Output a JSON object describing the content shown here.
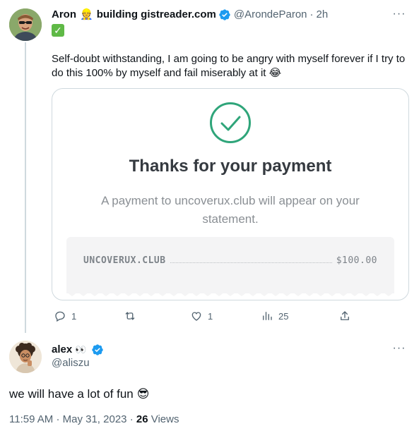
{
  "tweet1": {
    "author_name": "Aron",
    "name_emoji": "👷",
    "bio_text": "building gistreader.com",
    "handle": "@ArondeParon",
    "separator": "·",
    "time": "2h",
    "status_emoji": "✓",
    "text": "Self-doubt withstanding, I am going to be angry with myself forever if I try to do this 100% by myself and fail miserably at it 😂",
    "card": {
      "title": "Thanks for your payment",
      "subtitle": "A payment to uncoverux.club will appear on your statement.",
      "merchant": "UNCOVERUX.CLUB",
      "amount": "$100.00",
      "check_color": "#2fa57a"
    },
    "actions": {
      "replies": "1",
      "retweets": "",
      "likes": "1",
      "views": "25"
    },
    "more": "···"
  },
  "tweet2": {
    "author_name": "alex",
    "name_emoji": "👀",
    "handle": "@aliszu",
    "text": "we will have a lot of fun",
    "text_emoji": "😎",
    "time": "11:59 AM",
    "date": "May 31, 2023",
    "separator": "·",
    "views_count": "26",
    "views_label": "Views",
    "more": "···"
  },
  "colors": {
    "verified": "#1d9bf0",
    "secondary_text": "#536471",
    "border": "#cfd9de"
  }
}
